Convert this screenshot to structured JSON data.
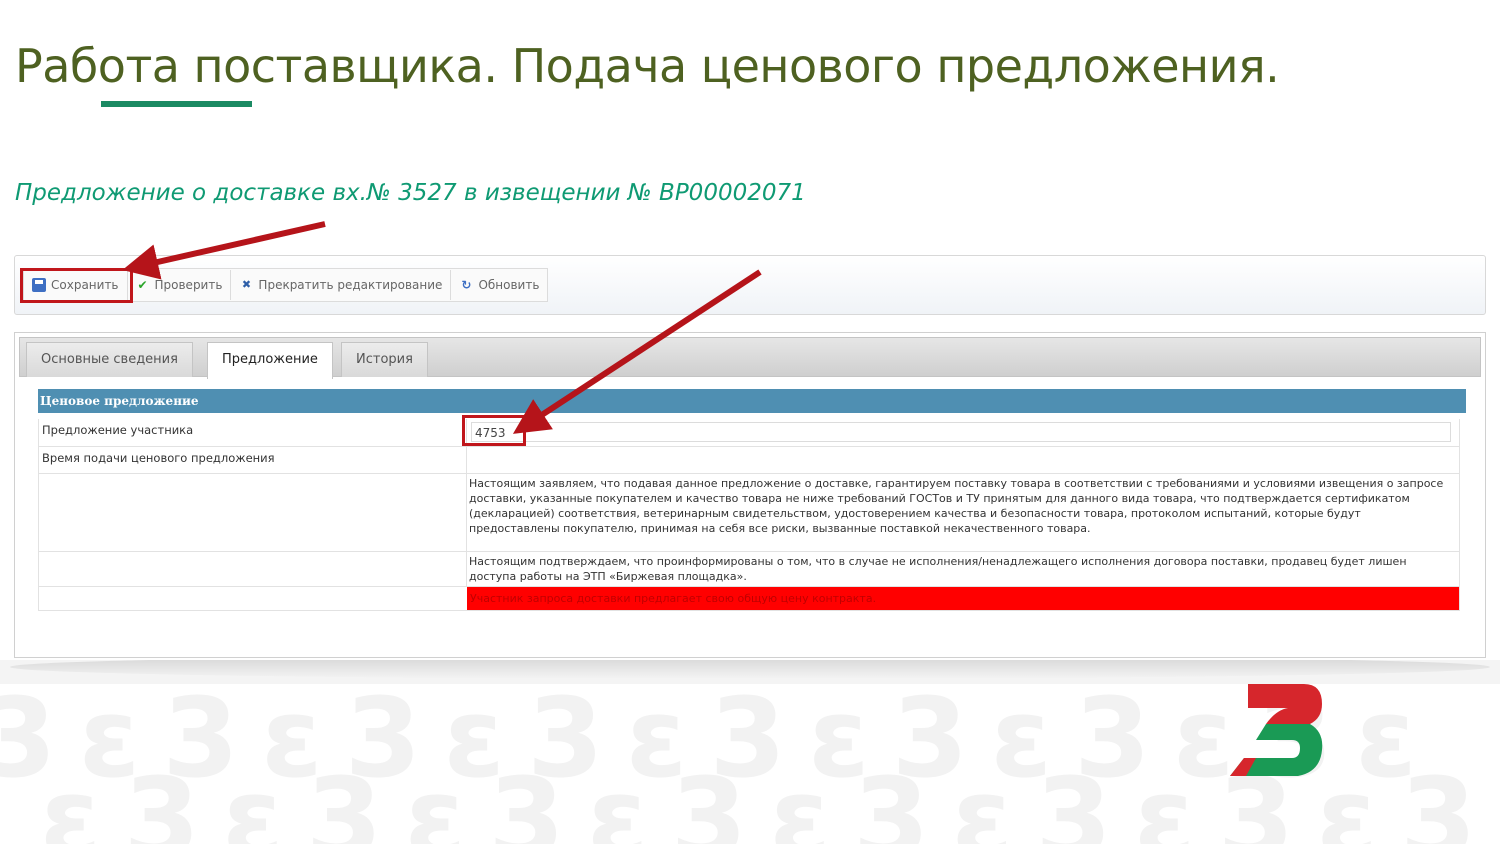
{
  "slide": {
    "title": "Работа поставщика. Подача ценового предложения."
  },
  "document": {
    "title": "Предложение о доставке вх.№ 3527 в извещении № ВР00002071"
  },
  "toolbar": {
    "buttons": [
      {
        "label": "Сохранить",
        "icon": "save-icon"
      },
      {
        "label": "Проверить",
        "icon": "check-icon"
      },
      {
        "label": "Прекратить редактирование",
        "icon": "close-icon"
      },
      {
        "label": "Обновить",
        "icon": "refresh-icon"
      }
    ]
  },
  "tabs": [
    {
      "label": "Основные сведения",
      "active": false
    },
    {
      "label": "Предложение",
      "active": true
    },
    {
      "label": "История",
      "active": false
    }
  ],
  "section": {
    "header": "Ценовое предложение",
    "participant_offer_label": "Предложение участника",
    "participant_offer_value": "4753",
    "submit_time_label": "Время подачи ценового предложения",
    "declaration_1": "Настоящим заявляем, что подавая данное предложение о доставке, гарантируем поставку товара в соответствии с требованиями и условиями извещения о запросе доставки, указанные покупателем и качество товара не ниже требований ГОСТов и ТУ принятым для данного вида товара, что подтверждается сертификатом (декларацией) соответствия, ветеринарным свидетельством, удостоверением качества и безопасности товара, протоколом испытаний, которые будут предоставлены покупателю, принимая на себя все риски, вызванные поставкой некачественного товара.",
    "declaration_2": "Настоящим подтверждаем, что проинформированы о том, что в случае не исполнения/ненадлежащего исполнения договора поставки, продавец будет лишен доступа работы на ЭТП «Биржевая площадка».",
    "warning": "Участник запроса доставки предлагает свою общую цену контракта."
  },
  "colors": {
    "title": "#4e6121",
    "doc_title": "#0f9a73",
    "section_header": "#4f8fb2",
    "highlight": "#c0161b",
    "warning_bg": "#ff0000"
  }
}
